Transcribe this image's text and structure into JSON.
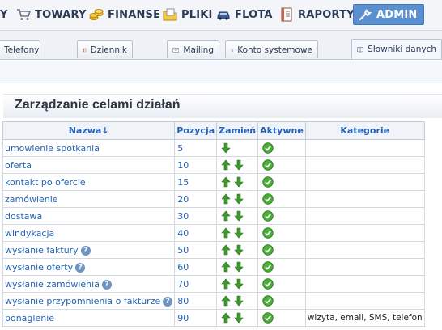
{
  "nav": {
    "items": [
      {
        "label": "Y",
        "icon": "cut-off-item"
      },
      {
        "label": "TOWARY",
        "icon": "cart-icon"
      },
      {
        "label": "FINANSE",
        "icon": "coins-icon"
      },
      {
        "label": "PLIKI",
        "icon": "folder-icon"
      },
      {
        "label": "FLOTA",
        "icon": "car-icon"
      },
      {
        "label": "RAPORTY",
        "icon": "report-icon"
      },
      {
        "label": "ADMIN",
        "icon": "wrench-icon",
        "active": true
      }
    ]
  },
  "tabs": [
    {
      "label": "Telefony"
    },
    {
      "label": "Dziennik",
      "icon": "journal-icon"
    },
    {
      "label": "Mailing",
      "icon": "mail-icon"
    },
    {
      "label": "Konto systemowe",
      "icon": "system-account-icon"
    },
    {
      "label": "Słowniki danych",
      "icon": "book-icon",
      "active": true
    }
  ],
  "page": {
    "title": "Zarządzanie celami działań"
  },
  "table": {
    "columns": [
      "Nazwa↓",
      "Pozycja",
      "Zamień",
      "Aktywne",
      "Kategorie"
    ],
    "rows": [
      {
        "name": "umowienie spotkania",
        "position": "5",
        "help": false,
        "up": false,
        "down": true,
        "active": true,
        "categories": ""
      },
      {
        "name": "oferta",
        "position": "10",
        "help": false,
        "up": true,
        "down": true,
        "active": true,
        "categories": ""
      },
      {
        "name": "kontakt po ofercie",
        "position": "15",
        "help": false,
        "up": true,
        "down": true,
        "active": true,
        "categories": ""
      },
      {
        "name": "zamówienie",
        "position": "20",
        "help": false,
        "up": true,
        "down": true,
        "active": true,
        "categories": ""
      },
      {
        "name": "dostawa",
        "position": "30",
        "help": false,
        "up": true,
        "down": true,
        "active": true,
        "categories": ""
      },
      {
        "name": "windykacja",
        "position": "40",
        "help": false,
        "up": true,
        "down": true,
        "active": true,
        "categories": ""
      },
      {
        "name": "wysłanie faktury",
        "position": "50",
        "help": true,
        "up": true,
        "down": true,
        "active": true,
        "categories": ""
      },
      {
        "name": "wysłanie oferty",
        "position": "60",
        "help": true,
        "up": true,
        "down": true,
        "active": true,
        "categories": ""
      },
      {
        "name": "wysłanie zamówienia",
        "position": "70",
        "help": true,
        "up": true,
        "down": true,
        "active": true,
        "categories": ""
      },
      {
        "name": "wysłanie przypomnienia o fakturze",
        "position": "80",
        "help": true,
        "up": true,
        "down": true,
        "active": true,
        "categories": ""
      },
      {
        "name": "ponaglenie",
        "position": "90",
        "help": false,
        "up": true,
        "down": true,
        "active": true,
        "categories": "wizyta, email, SMS, telefon"
      }
    ]
  },
  "colors": {
    "nav_active_bg": "#5a8fd0",
    "link": "#2563b6",
    "arrow_green": "#3f9a2e",
    "check_green": "#4caf3a"
  }
}
